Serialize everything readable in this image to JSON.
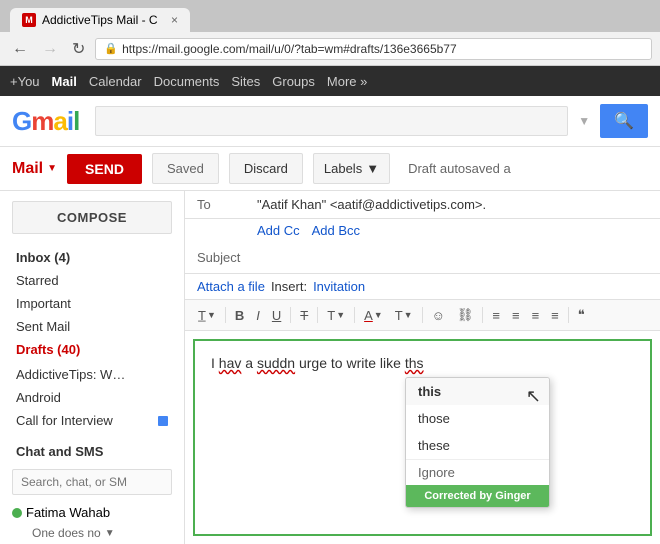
{
  "browser": {
    "tab_favicon": "M",
    "tab_title": "AddictiveTips Mail - C",
    "tab_close": "×",
    "url": "https://mail.google.com/mail/u/0/?tab=wm#drafts/136e3665b77",
    "back_disabled": false,
    "forward_disabled": true,
    "ssl_icon": "🔒"
  },
  "google_nav": {
    "plus": "+You",
    "mail": "Mail",
    "calendar": "Calendar",
    "documents": "Documents",
    "sites": "Sites",
    "groups": "Groups",
    "more": "More »"
  },
  "gmail_header": {
    "logo": "Gmail",
    "search_placeholder": "",
    "search_btn": "🔍"
  },
  "mail_nav": {
    "mail_label": "Mail",
    "send_btn": "SEND",
    "saved_btn": "Saved",
    "discard_btn": "Discard",
    "labels_btn": "Labels",
    "labels_arrow": "▼",
    "draft_status": "Draft autosaved a"
  },
  "sidebar": {
    "compose_btn": "COMPOSE",
    "items": [
      {
        "label": "Inbox (4)",
        "bold": true
      },
      {
        "label": "Starred",
        "bold": false
      },
      {
        "label": "Important",
        "bold": false
      },
      {
        "label": "Sent Mail",
        "bold": false
      },
      {
        "label": "Drafts (40)",
        "bold": true,
        "red": true
      }
    ],
    "more_items": [
      {
        "label": "AddictiveTips: W…"
      },
      {
        "label": "Android"
      },
      {
        "label": "Call for Interview"
      }
    ],
    "chat_section": "Chat and SMS",
    "chat_search_placeholder": "Search, chat, or SM",
    "chat_items": [
      {
        "name": "Fatima Wahab",
        "preview": "One does no",
        "status": "online"
      }
    ]
  },
  "compose": {
    "to_label": "To",
    "to_value": "\"Aatif Khan\" <aatif@addictivetips.com>.",
    "add_cc": "Add Cc",
    "add_bcc": "Add Bcc",
    "subject_label": "Subject",
    "subject_value": "",
    "attach_label": "Attach a file",
    "insert_label": "Insert:",
    "insert_value": "Invitation",
    "body_text": "I hav a suddn urge to write like ths",
    "toolbar": {
      "font": "T",
      "bold": "B",
      "italic": "I",
      "underline": "U",
      "strikethrough": "T",
      "font_size": "T",
      "font_color": "A",
      "more_formatting": "T",
      "emoji": "☺",
      "link": "🔗",
      "ordered_list": "≡",
      "unordered_list": "≡",
      "indent": "≡",
      "outdent": "≡",
      "quote": "❝"
    }
  },
  "ginger": {
    "option1": "this",
    "option2": "those",
    "option3": "these",
    "ignore": "Ignore",
    "footer_text": "Corrected by",
    "footer_brand": "Ginger"
  }
}
